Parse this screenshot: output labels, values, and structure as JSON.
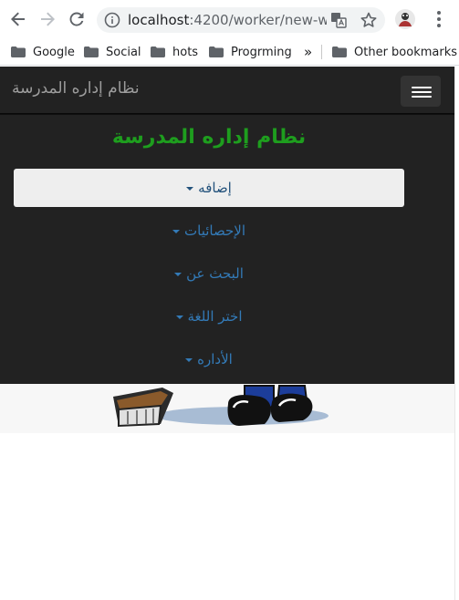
{
  "browser": {
    "url_host": "localhost",
    "url_rest": ":4200/worker/new-w...",
    "bookmarks": [
      {
        "label": "Google"
      },
      {
        "label": "Social"
      },
      {
        "label": "hots"
      },
      {
        "label": "Progrming"
      }
    ],
    "overflow": "»",
    "other_bookmarks": "Other bookmarks"
  },
  "navbar": {
    "brand": "نظام إداره المدرسة"
  },
  "menu": {
    "title": "نظام إداره المدرسة",
    "items": [
      {
        "label": "إضافه"
      },
      {
        "label": "الإحصائيات"
      },
      {
        "label": "البحث عن"
      },
      {
        "label": "اختر اللغة"
      },
      {
        "label": "الأداره"
      }
    ]
  },
  "colors": {
    "navbar_bg": "#222222",
    "title_green": "#1e9e1e",
    "link_blue": "#337ab7"
  }
}
